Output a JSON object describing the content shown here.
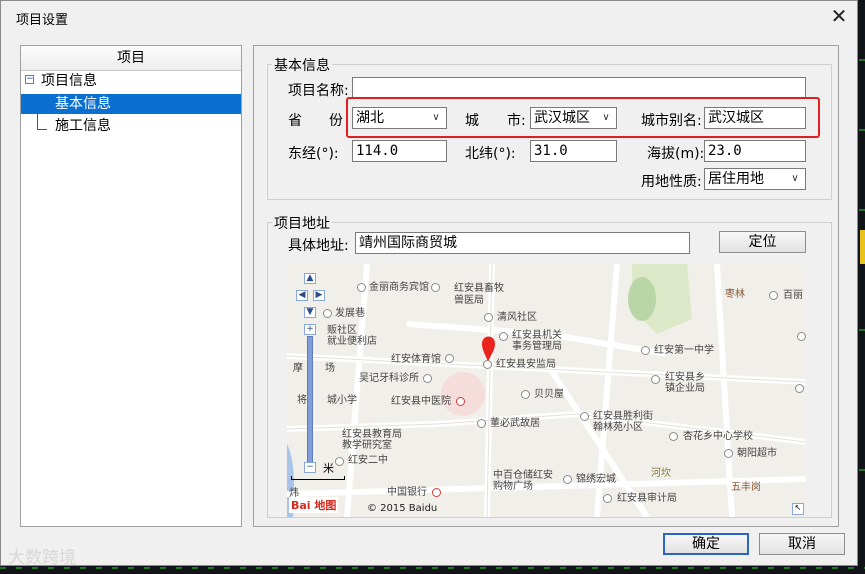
{
  "window": {
    "title": "项目设置"
  },
  "tree": {
    "header": "项目",
    "root_label": "项目信息",
    "items": [
      {
        "label": "基本信息",
        "selected": true
      },
      {
        "label": "施工信息",
        "selected": false
      }
    ]
  },
  "basic_info": {
    "group_title": "基本信息",
    "project_name": {
      "label": "项目名称:",
      "value": ""
    },
    "province": {
      "label_a": "省",
      "label_b": "份",
      "value": "湖北"
    },
    "city": {
      "label_a": "城",
      "label_b": "市:",
      "value": "武汉城区"
    },
    "city_alias": {
      "label": "城市别名:",
      "value": "武汉城区"
    },
    "longitude": {
      "label": "东经(°):",
      "value": "114.0"
    },
    "latitude": {
      "label": "北纬(°):",
      "value": "31.0"
    },
    "altitude": {
      "label": "海拔(m):",
      "value": "23.0"
    },
    "land_use": {
      "label": "用地性质:",
      "value": "居住用地"
    }
  },
  "address": {
    "group_title": "项目地址",
    "label": "具体地址:",
    "value": "靖州国际商贸城",
    "locate_button": "定位"
  },
  "map": {
    "pois": [
      "金丽商务宾馆",
      "红安县畜牧",
      "兽医局",
      "发展巷",
      "清风社区",
      "贩社区",
      "就业便利店",
      "红安县机关",
      "事务管理局",
      "红安体育馆",
      "红安县安监局",
      "红安第一中学",
      "摩",
      "场",
      "吴记牙科诊所",
      "红安县乡",
      "镇企业局",
      "贝贝屋",
      "将",
      "城小学",
      "红安县中医院",
      "红安县教育局",
      "教学研究室",
      "董必武故居",
      "红安县胜利街",
      "翰林苑小区",
      "杏花乡中心学校",
      "朝阳超市",
      "红安二中",
      "中百仓储红安",
      "购物广场",
      "锦绣宏城",
      "河坎",
      "五丰岗",
      "中国银行",
      "红安县审计局",
      "枣林",
      "百丽",
      "米",
      "炜"
    ],
    "logo": "Bai 地图",
    "copyright": "© 2015 Baidu"
  },
  "buttons": {
    "ok": "确定",
    "cancel": "取消"
  },
  "watermark": "大数跨境",
  "colors": {
    "selection": "#0a6fcf",
    "highlight_box": "#e02020",
    "map_marker": "#e8241c"
  }
}
